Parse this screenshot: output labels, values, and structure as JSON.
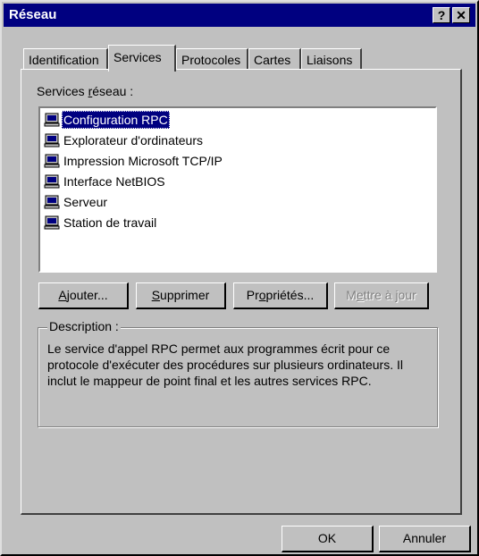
{
  "window": {
    "title": "Réseau",
    "help_glyph": "?",
    "close_glyph": "✕"
  },
  "tabs": [
    {
      "label": "Identification",
      "active": false
    },
    {
      "label": "Services",
      "active": true
    },
    {
      "label": "Protocoles",
      "active": false
    },
    {
      "label": "Cartes",
      "active": false
    },
    {
      "label": "Liaisons",
      "active": false
    }
  ],
  "services": {
    "label_before": "Services ",
    "label_u": "r",
    "label_after": "éseau :",
    "items": [
      {
        "label": "Configuration RPC",
        "selected": true,
        "icon": "computer-icon"
      },
      {
        "label": "Explorateur d'ordinateurs",
        "selected": false,
        "icon": "computer-icon"
      },
      {
        "label": "Impression Microsoft TCP/IP",
        "selected": false,
        "icon": "computer-icon"
      },
      {
        "label": "Interface NetBIOS",
        "selected": false,
        "icon": "computer-icon"
      },
      {
        "label": "Serveur",
        "selected": false,
        "icon": "computer-icon"
      },
      {
        "label": "Station de travail",
        "selected": false,
        "icon": "computer-icon"
      }
    ]
  },
  "buttons": {
    "add": {
      "u": "A",
      "rest": "jouter..."
    },
    "remove": {
      "u": "S",
      "rest": "upprimer"
    },
    "properties": {
      "pre": "Pr",
      "u": "o",
      "rest": "priétés..."
    },
    "update": {
      "pre": "M",
      "u": "e",
      "rest": "ttre à jour",
      "enabled": false
    },
    "ok": "OK",
    "cancel": "Annuler"
  },
  "description": {
    "legend": "Description :",
    "text": "Le service d'appel RPC permet aux programmes écrit pour ce protocole d'exécuter des procédures sur plusieurs ordinateurs. Il inclut le mappeur de point final et les autres services RPC."
  },
  "colors": {
    "face": "#c0c0c0",
    "titlebar": "#000080",
    "selection": "#000080"
  }
}
